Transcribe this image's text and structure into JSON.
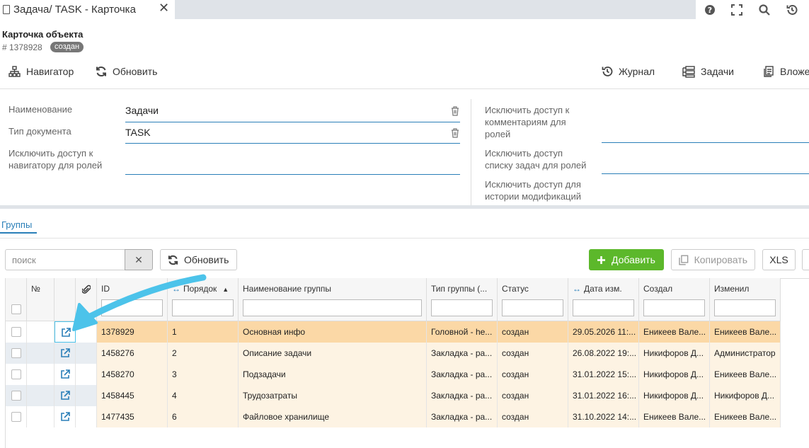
{
  "tab": {
    "title": "Задача/ TASK - Карточка",
    "close": "✕"
  },
  "top_icons": [
    "help-icon",
    "fullscreen-icon",
    "search-icon",
    "history-icon"
  ],
  "header": {
    "title": "Карточка объекта",
    "id": "# 1378928",
    "status": "создан"
  },
  "toolbar": {
    "navigator": "Навигатор",
    "refresh": "Обновить",
    "journal": "Журнал",
    "tasks": "Задачи",
    "attachments": "Вложе"
  },
  "form": {
    "name_label": "Наименование",
    "name_value": "Задачи",
    "doctype_label": "Тип документа",
    "doctype_value": "TASK",
    "nav_access_label_1": "Исключить доступ к",
    "nav_access_label_2": "навигатору для ролей",
    "comment_access_label_1": "Исключить доступ к",
    "comment_access_label_2": "комментариям для",
    "comment_access_label_3": "ролей",
    "tasklist_access_label_1": "Исключить доступ",
    "tasklist_access_label_2": "списку задач для ролей",
    "history_access_label_1": "Исключить доступ для",
    "history_access_label_2": "истории модификаций"
  },
  "tabs": {
    "groups": "Группы"
  },
  "grid_toolbar": {
    "search_placeholder": "поиск",
    "clear": "✕",
    "refresh": "Обновить",
    "add": "Добавить",
    "copy": "Копировать",
    "xls": "XLS"
  },
  "grid": {
    "columns": {
      "num": "№",
      "id": "ID",
      "order": "Порядок",
      "group_name": "Наименование группы",
      "group_type": "Тип группы (...",
      "status": "Статус",
      "date_modified": "Дата изм.",
      "created_by": "Создал",
      "modified_by": "Изменил"
    },
    "rows": [
      {
        "id": "1378929",
        "order": "1",
        "name": "Основная инфо",
        "type": "Головной - he...",
        "status": "создан",
        "date": "29.05.2026 11:...",
        "created": "Еникеев Вале...",
        "modified": "Еникеев Вале..."
      },
      {
        "id": "1458276",
        "order": "2",
        "name": "Описание задачи",
        "type": "Закладка - ра...",
        "status": "создан",
        "date": "26.08.2022 19:...",
        "created": "Никифоров Д...",
        "modified": "Администратор"
      },
      {
        "id": "1458270",
        "order": "3",
        "name": "Подзадачи",
        "type": "Закладка - ра...",
        "status": "создан",
        "date": "31.01.2022 15:...",
        "created": "Никифоров Д...",
        "modified": "Еникеев Вале..."
      },
      {
        "id": "1458445",
        "order": "4",
        "name": "Трудозатраты",
        "type": "Закладка - ра...",
        "status": "создан",
        "date": "31.01.2022 16:...",
        "created": "Никифоров Д...",
        "modified": "Никифоров Д..."
      },
      {
        "id": "1477435",
        "order": "6",
        "name": "Файловое хранилище",
        "type": "Закладка - ра...",
        "status": "создан",
        "date": "31.10.2022 14:...",
        "created": "Еникеев Вале...",
        "modified": "Еникеев Вале..."
      }
    ]
  },
  "colors": {
    "accent": "#2a7fb8",
    "add_button": "#5cb82b",
    "row_selected": "#fbd8a6",
    "row_alt": "#fdf3e3",
    "annotation_arrow": "#4cc3ea"
  }
}
